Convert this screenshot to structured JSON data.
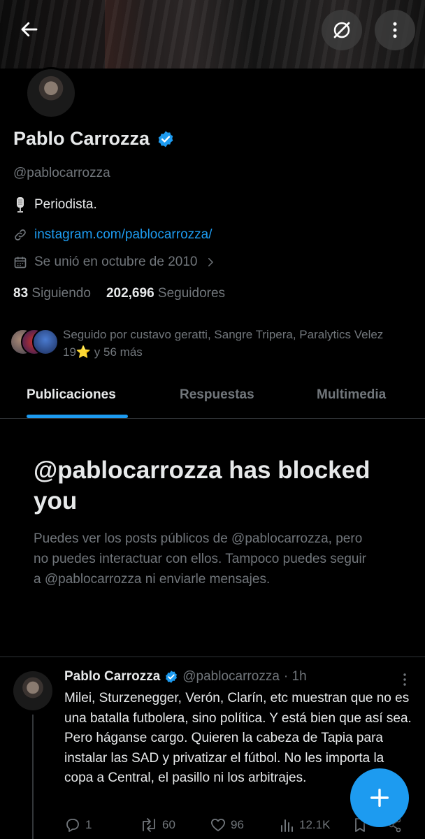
{
  "profile": {
    "name": "Pablo Carrozza",
    "handle": "@pablocarrozza",
    "bio_icon": "microphone-emoji",
    "bio": "Periodista.",
    "link": "instagram.com/pablocarrozza/",
    "joined": "Se unió en octubre de 2010",
    "following_count": "83",
    "following_label": "Siguiendo",
    "followers_count": "202,696",
    "followers_label": "Seguidores",
    "followed_by": "Seguido por custavo geratti, Sangre Tripera, Paralytics Velez 19⭐ y 56 más"
  },
  "tabs": [
    "Publicaciones",
    "Respuestas",
    "Multimedia"
  ],
  "blocked": {
    "title": "@pablocarrozza has blocked you",
    "description": "Puedes ver los posts públicos de @pablocarrozza, pero no puedes interactuar con ellos. Tampoco puedes seguir a @pablocarrozza ni enviarle mensajes."
  },
  "post": {
    "author": "Pablo Carrozza",
    "handle": "@pablocarrozza",
    "time": "· 1h",
    "text": "Milei, Sturzenegger, Verón, Clarín, etc muestran que no es una batalla futbolera, sino política. Y está bien que así sea. Pero háganse cargo. Quieren la cabeza de Tapia para instalar las SAD y privatizar el fútbol. No les importa la copa a Central, el pasillo ni los arbitrajes.",
    "replies": "1",
    "reposts": "60",
    "likes": "96",
    "views": "12.1K"
  },
  "colors": {
    "accent": "#1d9bf0",
    "text": "#e7e9ea",
    "muted": "#71767b",
    "background": "#000000"
  },
  "icons": {
    "back": "arrow-left-icon",
    "grok": "grok-icon",
    "more": "more-vertical-icon",
    "verified": "verified-badge-icon",
    "link": "link-icon",
    "calendar": "calendar-icon",
    "fab": "plus-icon"
  }
}
